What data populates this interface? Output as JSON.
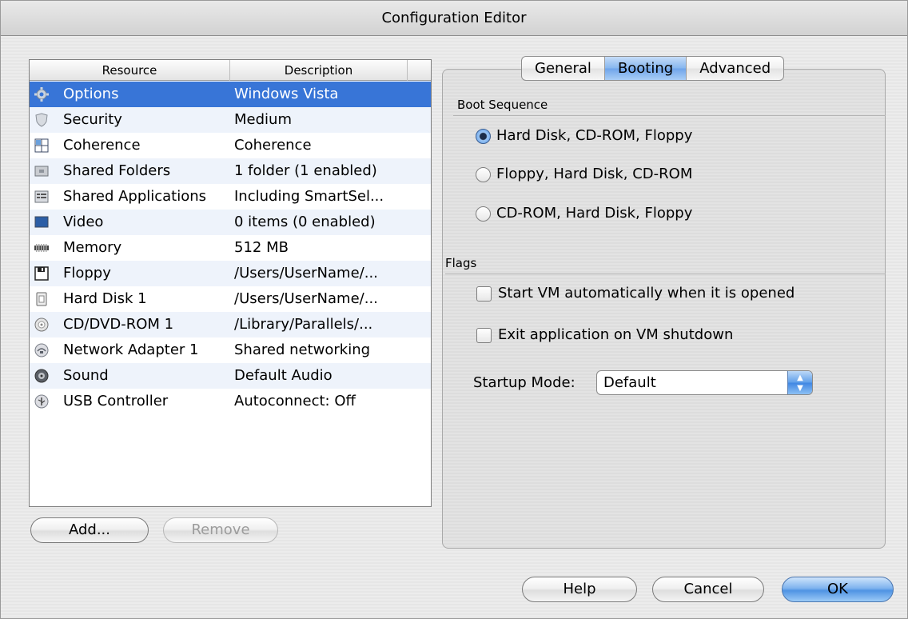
{
  "window": {
    "title": "Configuration Editor"
  },
  "table": {
    "headers": {
      "resource": "Resource",
      "description": "Description"
    },
    "rows": [
      {
        "icon": "gear-icon",
        "name": "Options",
        "description": "Windows Vista",
        "selected": true
      },
      {
        "icon": "shield-icon",
        "name": "Security",
        "description": "Medium"
      },
      {
        "icon": "coherence-icon",
        "name": "Coherence",
        "description": "Coherence"
      },
      {
        "icon": "shared-folder-icon",
        "name": "Shared Folders",
        "description": "1 folder (1 enabled)"
      },
      {
        "icon": "shared-applications-icon",
        "name": "Shared Applications",
        "description": "Including SmartSel..."
      },
      {
        "icon": "video-icon",
        "name": "Video",
        "description": "0 items (0 enabled)"
      },
      {
        "icon": "memory-icon",
        "name": "Memory",
        "description": "512 MB"
      },
      {
        "icon": "floppy-icon",
        "name": "Floppy",
        "description": "/Users/UserName/..."
      },
      {
        "icon": "hard-disk-icon",
        "name": "Hard Disk 1",
        "description": "/Users/UserName/..."
      },
      {
        "icon": "cd-dvd-icon",
        "name": "CD/DVD-ROM 1",
        "description": "/Library/Parallels/..."
      },
      {
        "icon": "network-adapter-icon",
        "name": "Network Adapter 1",
        "description": "Shared networking"
      },
      {
        "icon": "sound-icon",
        "name": "Sound",
        "description": "Default Audio"
      },
      {
        "icon": "usb-icon",
        "name": "USB Controller",
        "description": "Autoconnect: Off"
      }
    ]
  },
  "buttons": {
    "add": "Add...",
    "remove": "Remove",
    "help": "Help",
    "cancel": "Cancel",
    "ok": "OK"
  },
  "tabs": [
    {
      "label": "General",
      "active": false
    },
    {
      "label": "Booting",
      "active": true
    },
    {
      "label": "Advanced",
      "active": false
    }
  ],
  "boot": {
    "section_title": "Boot Sequence",
    "options": [
      {
        "label": "Hard Disk, CD-ROM, Floppy",
        "selected": true
      },
      {
        "label": "Floppy, Hard Disk, CD-ROM",
        "selected": false
      },
      {
        "label": "CD-ROM, Hard Disk, Floppy",
        "selected": false
      }
    ]
  },
  "flags": {
    "section_title": "Flags",
    "start_vm_auto": {
      "label": "Start VM automatically when it is opened",
      "checked": false
    },
    "exit_on_shutdown": {
      "label": "Exit application on VM shutdown",
      "checked": false
    },
    "startup_mode": {
      "label": "Startup Mode:",
      "value": "Default"
    }
  },
  "colors": {
    "selection": "#3875d7",
    "alt_row": "#eef3fb",
    "default_button": "#4f93e3"
  }
}
